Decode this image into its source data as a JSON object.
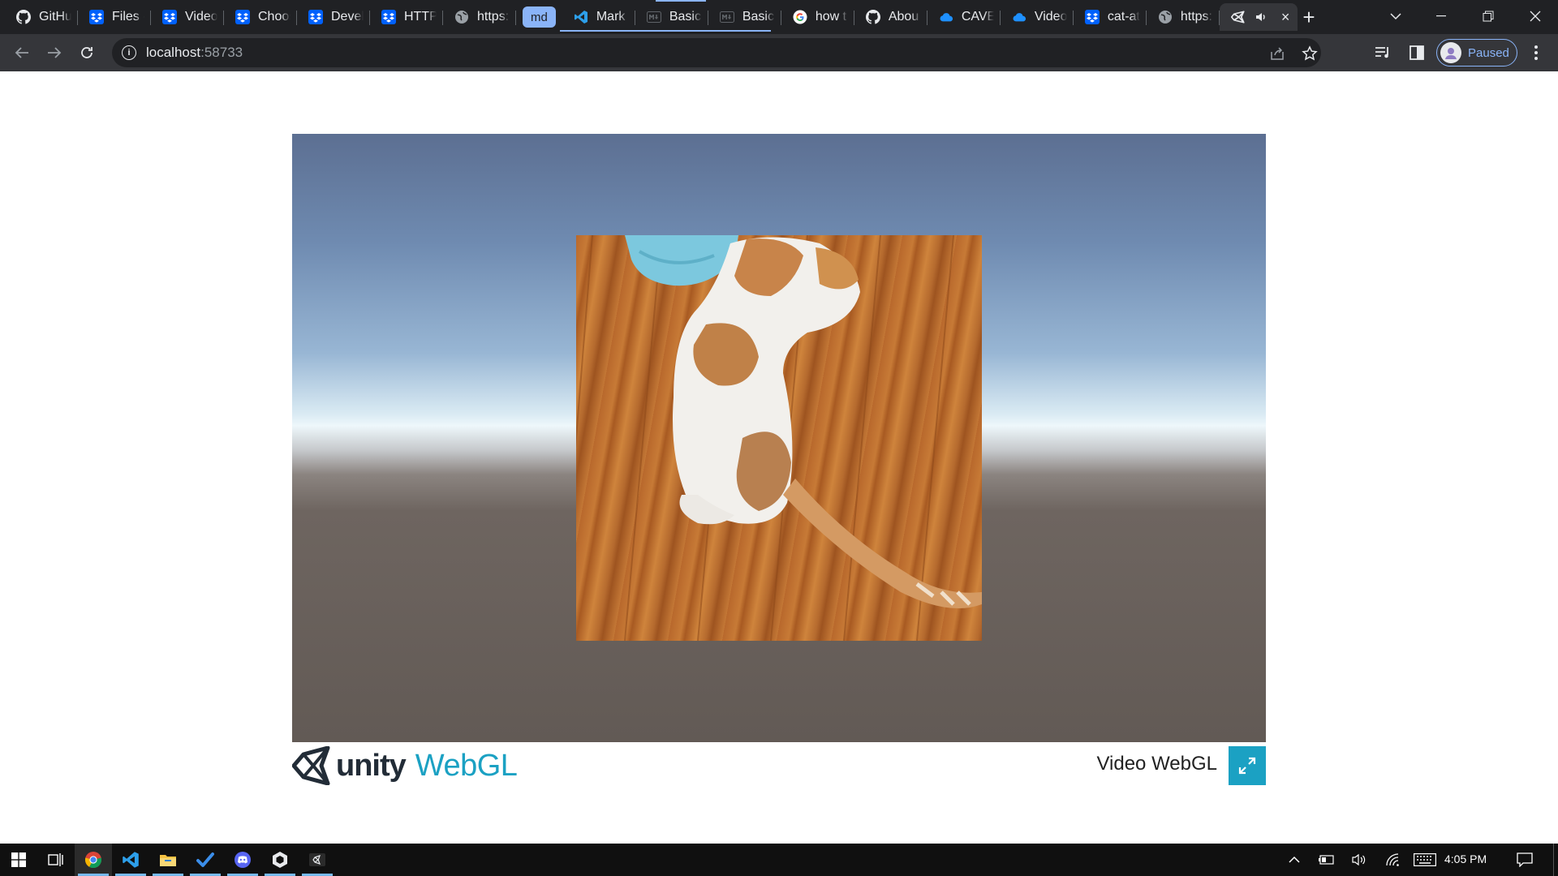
{
  "browser": {
    "tabs": [
      {
        "label": "GitHu",
        "icon": "github-icon"
      },
      {
        "label": "Files -",
        "icon": "dropbox-icon"
      },
      {
        "label": "Video",
        "icon": "dropbox-icon"
      },
      {
        "label": "Choos",
        "icon": "dropbox-icon"
      },
      {
        "label": "Devel",
        "icon": "dropbox-icon"
      },
      {
        "label": "HTTP",
        "icon": "dropbox-icon"
      },
      {
        "label": "https:",
        "icon": "globe-icon"
      },
      {
        "label": "Mark",
        "icon": "vscode-icon"
      },
      {
        "label": "Basic",
        "icon": "markdown-icon"
      },
      {
        "label": "Basic",
        "icon": "markdown-icon"
      },
      {
        "label": "how t",
        "icon": "google-icon"
      },
      {
        "label": "Abou",
        "icon": "github-icon"
      },
      {
        "label": "CAVE",
        "icon": "onedrive-icon"
      },
      {
        "label": "Video",
        "icon": "onedrive-icon"
      },
      {
        "label": "cat-at",
        "icon": "dropbox-icon"
      },
      {
        "label": "https:",
        "icon": "globe-icon"
      }
    ],
    "tab_group_label": "md",
    "group_color": "#8ab4f8",
    "active_tab": {
      "icon": "unity-icon",
      "audio": "speaker-icon",
      "close": "×"
    },
    "new_tab": "+",
    "address": {
      "host": "localhost",
      "port": ":58733"
    },
    "profile_status": "Paused"
  },
  "page": {
    "title": "Video WebGL",
    "logo_unity": "unity",
    "logo_webgl": "WebGL",
    "accent": "#1ba1c3"
  },
  "taskbar": {
    "clock": "4:05 PM",
    "apps": [
      "windows-start-icon",
      "task-view-icon",
      "chrome-icon",
      "vscode-icon",
      "file-explorer-icon",
      "todo-icon",
      "discord-icon",
      "unity-hub-icon",
      "unity-editor-icon"
    ]
  }
}
